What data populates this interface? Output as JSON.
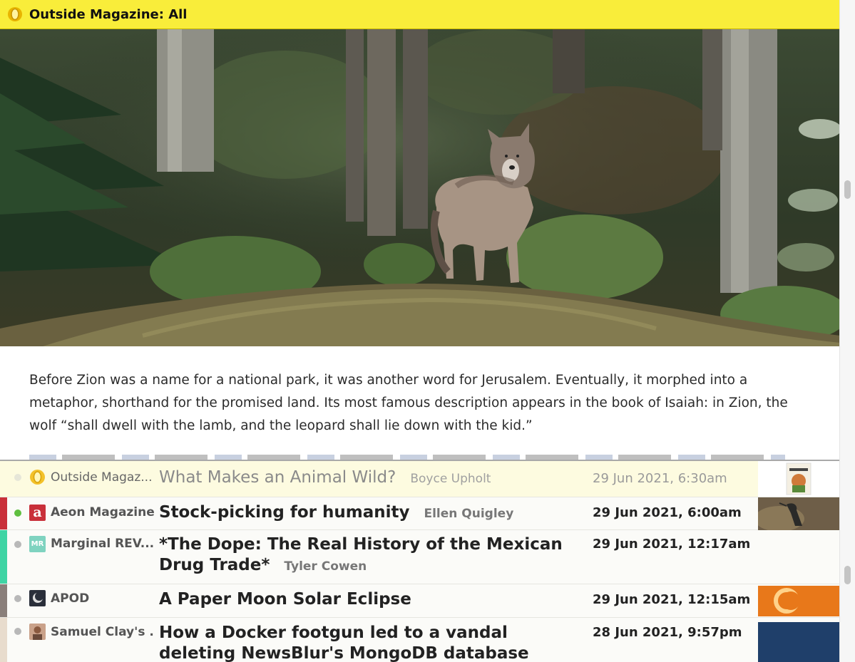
{
  "header": {
    "title": "Outside Magazine: All",
    "color": "#f9ed3a"
  },
  "article": {
    "paragraph": "Before Zion was a name for a national park, it was another word for Jerusalem. Eventually, it morphed into a metaphor, shorthand for the promised land. Its most famous description appears in the book of Isaiah: in Zion, the wolf “shall dwell with the lamb, and the leopard shall lie down with the kid.”"
  },
  "stories": [
    {
      "feed": "Outside Magaz...",
      "title": "What Makes an Animal Wild?",
      "author": "Boyce Upholt",
      "date": "29 Jun 2021, 6:30am",
      "status": "read",
      "selected": true,
      "feed_color": "#f9ed3a",
      "icon": "outside-magazine-icon"
    },
    {
      "feed": "Aeon Magazine",
      "title": "Stock-picking for humanity",
      "author": "Ellen Quigley",
      "date": "29 Jun 2021, 6:00am",
      "status": "unread-focus",
      "feed_color": "#c9303a",
      "icon": "aeon-icon"
    },
    {
      "feed": "Marginal REV...",
      "title": "*The Dope: The Real History of the Mexican Drug Trade*",
      "author": "Tyler Cowen",
      "date": "29 Jun 2021, 12:17am",
      "status": "unread",
      "feed_color": "#3fd4a4",
      "icon": "marginal-revolution-icon"
    },
    {
      "feed": "APOD",
      "title": "A Paper Moon Solar Eclipse",
      "author": "",
      "date": "29 Jun 2021, 12:15am",
      "status": "unread",
      "feed_color": "#8a7f7a",
      "icon": "apod-icon"
    },
    {
      "feed": "Samuel Clay's ...",
      "title": "How a Docker footgun led to a vandal deleting NewsBlur's MongoDB database",
      "author": "",
      "date": "28 Jun 2021, 9:57pm",
      "status": "unread",
      "feed_color": "#e8dccd",
      "icon": "samuel-clay-avatar-icon"
    }
  ]
}
